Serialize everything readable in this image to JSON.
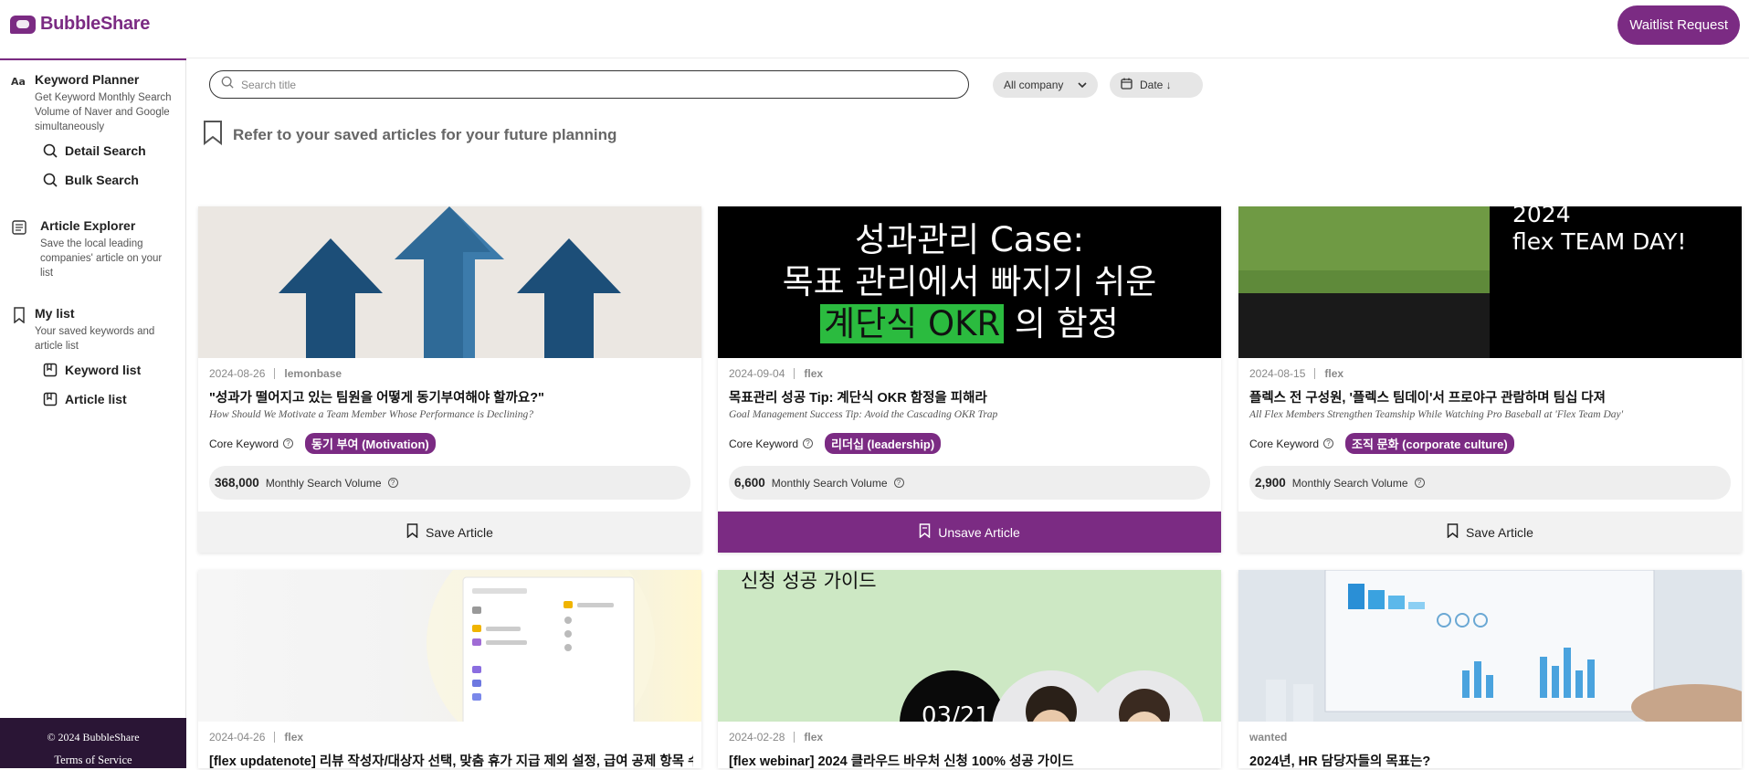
{
  "header": {
    "logo_text": "BubbleShare",
    "waitlist_label": "Waitlist Request"
  },
  "sidebar": {
    "keyword_planner": {
      "title": "Keyword Planner",
      "desc": "Get Keyword Monthly Search Volume of Naver and Google simultaneously",
      "items": [
        {
          "label": "Detail Search",
          "icon": "search-icon"
        },
        {
          "label": "Bulk Search",
          "icon": "search-icon"
        }
      ]
    },
    "article_explorer": {
      "title": "Article Explorer",
      "desc": "Save the local leading companies' article on your list"
    },
    "my_list": {
      "title": "My list",
      "desc": "Your saved keywords and article list",
      "items": [
        {
          "label": "Keyword list",
          "icon": "list-icon"
        },
        {
          "label": "Article list",
          "icon": "list-icon"
        }
      ]
    },
    "footer": {
      "copyright": "© 2024 BubbleShare",
      "terms": "Terms of Service"
    }
  },
  "toolbar": {
    "search_placeholder": "Search title",
    "company_filter": "All company",
    "date_sort": "Date ↓"
  },
  "saved_hint": "Refer to your saved articles for your future planning",
  "colors": {
    "brand": "#7b2b83",
    "footer_bg": "#2a1535"
  },
  "cards": [
    {
      "date": "2024-08-26",
      "company": "lemonbase",
      "title": "\"성과가 떨어지고 있는 팀원을 어떻게 동기부여해야 할까요?\"",
      "subtitle": "How Should We Motivate a Team Member Whose Performance is Declining?",
      "core_keyword_label": "Core Keyword",
      "keyword": "동기 부여 (Motivation)",
      "volume": "368,000",
      "volume_label": "Monthly Search Volume",
      "button": "Save Article",
      "saved": false
    },
    {
      "date": "2024-09-04",
      "company": "flex",
      "title": "목표관리 성공 Tip: 계단식 OKR 함정을 피해라",
      "subtitle": "Goal Management Success Tip: Avoid the Cascading OKR Trap",
      "core_keyword_label": "Core Keyword",
      "keyword": "리더십 (leadership)",
      "volume": "6,600",
      "volume_label": "Monthly Search Volume",
      "button": "Unsave Article",
      "saved": true,
      "image_text": {
        "line1": "성과관리 Case:",
        "line2": "목표 관리에서 빠지기 쉬운",
        "highlight": "계단식 OKR",
        "line3_rest": "의 함정"
      }
    },
    {
      "date": "2024-08-15",
      "company": "flex",
      "title": "플렉스 전 구성원, '플렉스 팀데이'서 프로야구 관람하며 팀십 다져",
      "subtitle": "All Flex Members Strengthen Teamship While Watching Pro Baseball at 'Flex Team Day'",
      "core_keyword_label": "Core Keyword",
      "keyword": "조직 문화 (corporate culture)",
      "volume": "2,900",
      "volume_label": "Monthly Search Volume",
      "button": "Save Article",
      "saved": false,
      "image_text": {
        "line1": "2024",
        "line2": "flex TEAM DAY!"
      }
    },
    {
      "date": "2024-04-26",
      "company": "flex",
      "title": "[flex updatenote] 리뷰 작성자/대상자 선택, 맞춤 휴가 지급 제외 설정, 급여 공제 항목 수"
    },
    {
      "date": "2024-02-28",
      "company": "flex",
      "title": "[flex webinar] 2024 클라우드 바우처 신청 100% 성공 가이드",
      "image_text": {
        "line1": "신청 성공 가이드",
        "date_badge": "03/21"
      }
    },
    {
      "date": "",
      "company": "wanted",
      "title": "2024년, HR 담당자들의 목표는?"
    }
  ]
}
